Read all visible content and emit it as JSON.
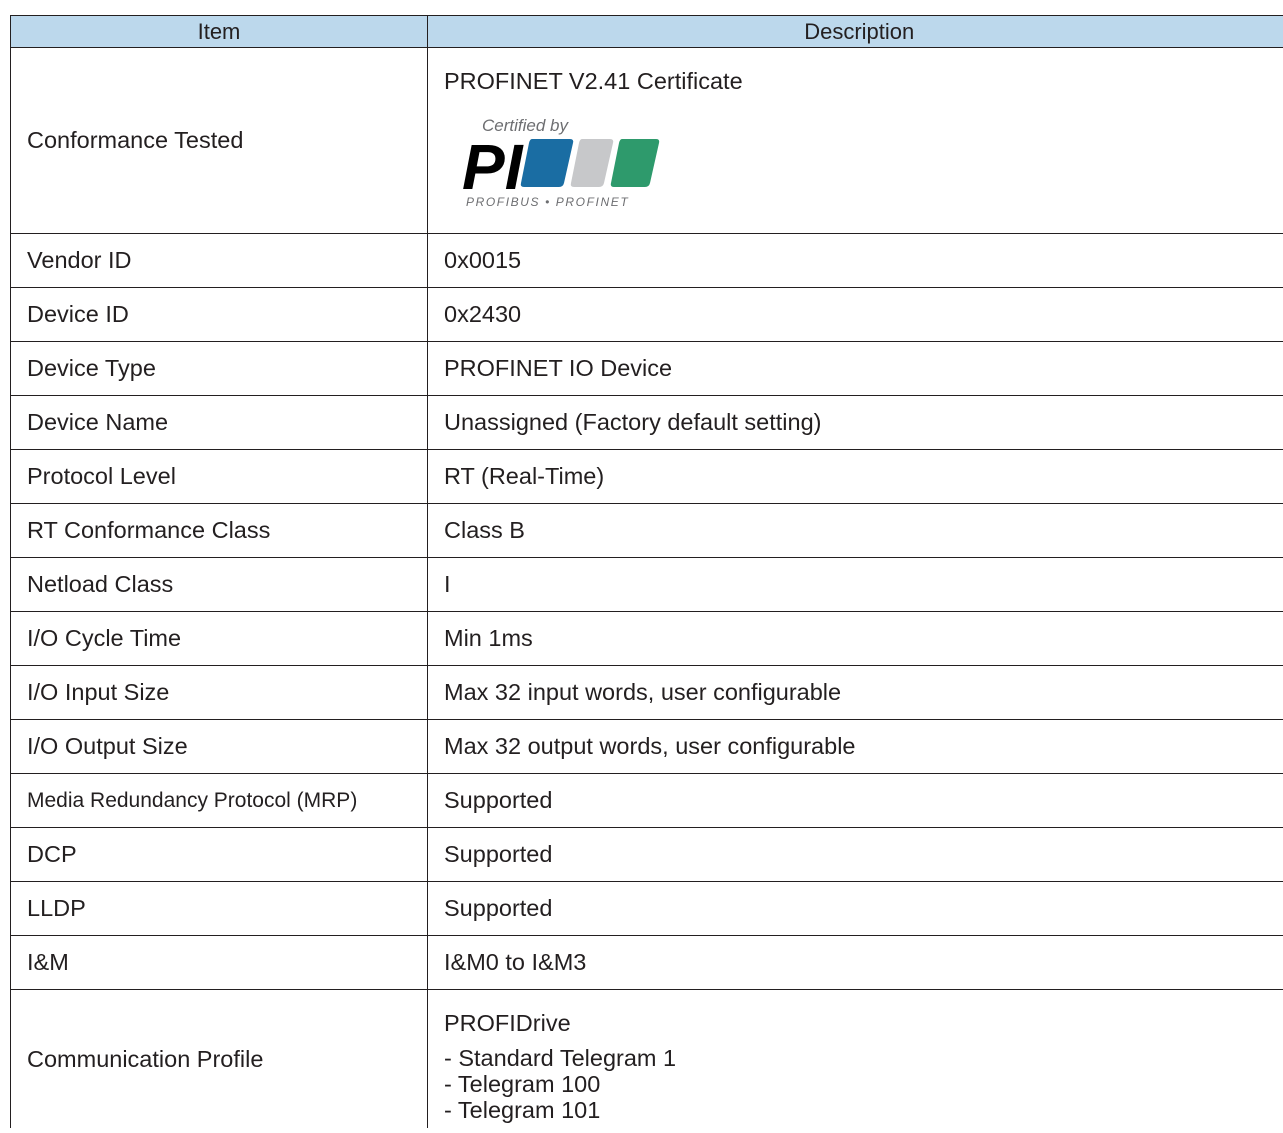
{
  "table": {
    "headers": {
      "item": "Item",
      "description": "Description"
    },
    "conformance": {
      "item": "Conformance Tested",
      "certificate": "PROFINET V2.41 Certificate",
      "logo": {
        "certified_by": "Certified by",
        "mark": "PI",
        "tagline": "PROFIBUS • PROFINET",
        "colors": [
          "#1a6da3",
          "#c7c8ca",
          "#2e9a6c"
        ]
      }
    },
    "rows": [
      {
        "item": "Vendor ID",
        "description": "0x0015"
      },
      {
        "item": "Device ID",
        "description": "0x2430"
      },
      {
        "item": "Device Type",
        "description": "PROFINET IO Device"
      },
      {
        "item": "Device Name",
        "description": "Unassigned (Factory default setting)"
      },
      {
        "item": "Protocol Level",
        "description": "RT (Real-Time)"
      },
      {
        "item": "RT Conformance Class",
        "description": "Class B"
      },
      {
        "item": "Netload Class",
        "description": "I"
      },
      {
        "item": "I/O Cycle Time",
        "description": "Min 1ms"
      },
      {
        "item": "I/O Input Size",
        "description": "Max 32 input words, user configurable"
      },
      {
        "item": "I/O Output Size",
        "description": "Max 32 output words, user configurable"
      },
      {
        "item": "Media Redundancy Protocol (MRP)",
        "description": "Supported"
      },
      {
        "item": "DCP",
        "description": "Supported"
      },
      {
        "item": "LLDP",
        "description": "Supported"
      },
      {
        "item": "I&M",
        "description": "I&M0 to I&M3"
      }
    ],
    "profile": {
      "item": "Communication Profile",
      "title": "PROFIDrive",
      "telegrams": [
        "- Standard Telegram 1",
        "- Telegram 100",
        "- Telegram 101"
      ]
    }
  },
  "colors": {
    "header_background": "#bcd8ec",
    "border": "#231f20",
    "text": "#231f20"
  }
}
